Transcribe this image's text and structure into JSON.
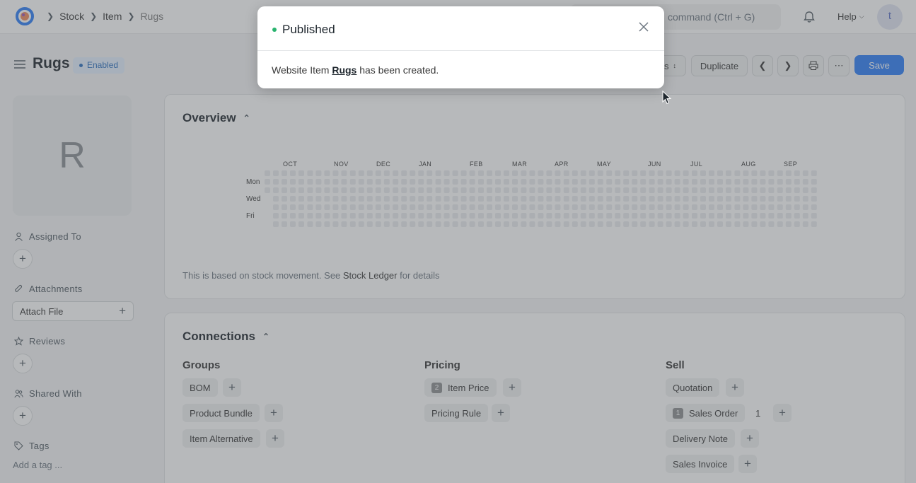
{
  "breadcrumb": [
    "Stock",
    "Item",
    "Rugs"
  ],
  "search": {
    "placeholder": "command (Ctrl + G)"
  },
  "help_label": "Help",
  "user_initial": "t",
  "page": {
    "title": "Rugs",
    "status": "Enabled"
  },
  "toolbar": {
    "partial_label": "s",
    "duplicate_label": "Duplicate",
    "save_label": "Save"
  },
  "sidebar": {
    "image_letter": "R",
    "assigned_to": "Assigned To",
    "attachments": "Attachments",
    "attach_file": "Attach File",
    "reviews": "Reviews",
    "shared_with": "Shared With",
    "tags": "Tags",
    "add_tag": "Add a tag ..."
  },
  "overview": {
    "title": "Overview",
    "months": [
      "OCT",
      "NOV",
      "DEC",
      "JAN",
      "FEB",
      "MAR",
      "APR",
      "MAY",
      "JUN",
      "JUL",
      "AUG",
      "SEP"
    ],
    "days": [
      "Mon",
      "Wed",
      "Fri"
    ],
    "note_prefix": "This is based on stock movement. See ",
    "note_link": "Stock Ledger",
    "note_suffix": " for details"
  },
  "connections": {
    "title": "Connections",
    "groups": [
      {
        "title": "Groups",
        "items": [
          {
            "label": "BOM"
          },
          {
            "label": "Product Bundle"
          },
          {
            "label": "Item Alternative"
          }
        ]
      },
      {
        "title": "Pricing",
        "items": [
          {
            "label": "Item Price",
            "count": "2"
          },
          {
            "label": "Pricing Rule"
          }
        ]
      },
      {
        "title": "Sell",
        "items": [
          {
            "label": "Quotation"
          },
          {
            "label": "Sales Order",
            "count": "1",
            "open_count": "1"
          },
          {
            "label": "Delivery Note"
          },
          {
            "label": "Sales Invoice"
          }
        ]
      }
    ]
  },
  "dialog": {
    "title": "Published",
    "message_prefix": "Website Item ",
    "message_link": "Rugs",
    "message_suffix": " has been created."
  },
  "colors": {
    "primary": "#2d7ff9",
    "success_dot": "#29b36e",
    "heatmap_cell": "#ebedf0"
  }
}
